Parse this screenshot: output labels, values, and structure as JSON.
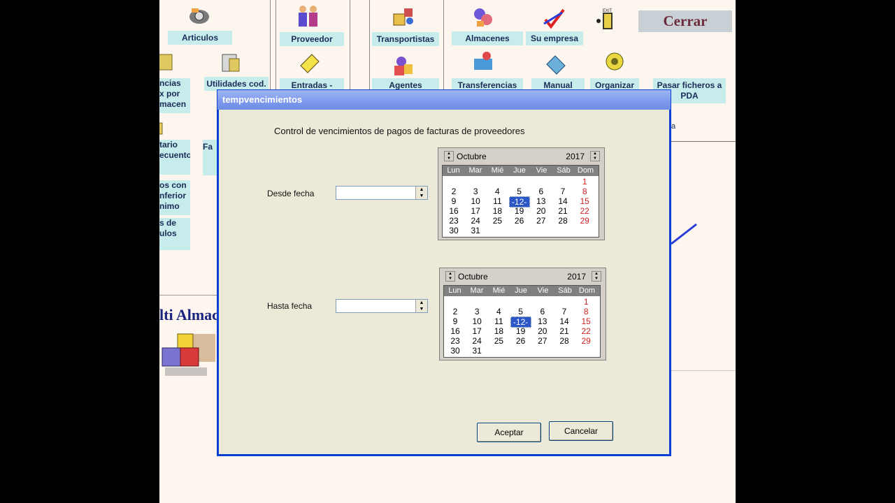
{
  "background_app": {
    "tiles": [
      "Articulos",
      "Proveedor",
      "Transportistas",
      "Almacenes",
      "Su empresa",
      "Utilidades cod.",
      "Entradas -",
      "Agentes",
      "Transferencias",
      "Manual",
      "Organizar",
      "Pasar ficheros a PDA"
    ],
    "left_fragments": [
      "ncias",
      "x por",
      "macen",
      "tario",
      "ecuento",
      "os con",
      "nferior",
      "nimo",
      "s de",
      "ulos"
    ],
    "misc_fragments": [
      "Fa",
      "a"
    ],
    "close_button": "Cerrar",
    "brand_fragment": "lti Almac"
  },
  "dialog": {
    "title": "tempvencimientos",
    "heading": "Control de vencimientos de pagos de facturas de proveedores",
    "from_label": "Desde fecha",
    "to_label": "Hasta fecha",
    "from_value": "",
    "to_value": "",
    "accept_label": "Aceptar",
    "cancel_label": "Cancelar",
    "calendars": [
      {
        "month": "Octubre",
        "year": "2017",
        "selected": "-12-"
      },
      {
        "month": "Octubre",
        "year": "2017",
        "selected": "-12-"
      }
    ],
    "weekdays": [
      "Lun",
      "Mar",
      "Mié",
      "Jue",
      "Vie",
      "Sáb",
      "Dom"
    ],
    "days": [
      "1",
      "2",
      "3",
      "4",
      "5",
      "6",
      "7",
      "8",
      "9",
      "10",
      "11",
      "12",
      "13",
      "14",
      "15",
      "16",
      "17",
      "18",
      "19",
      "20",
      "21",
      "22",
      "23",
      "24",
      "25",
      "26",
      "27",
      "28",
      "29",
      "30",
      "31"
    ]
  }
}
